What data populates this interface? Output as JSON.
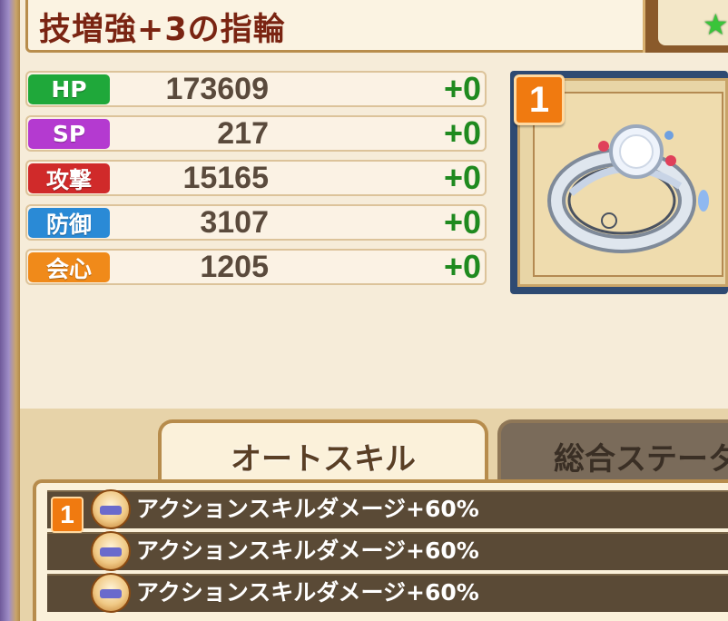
{
  "item": {
    "name": "技増強+3の指輪",
    "rarity": "1"
  },
  "stats": [
    {
      "label": "HP",
      "value": "173609",
      "bonus": "+0",
      "color": "#1fa83a"
    },
    {
      "label": "SP",
      "value": "217",
      "bonus": "+0",
      "color": "#b43ad0"
    },
    {
      "label": "攻撃",
      "value": "15165",
      "bonus": "+0",
      "color": "#d02a2a"
    },
    {
      "label": "防御",
      "value": "3107",
      "bonus": "+0",
      "color": "#2a8ad6"
    },
    {
      "label": "会心",
      "value": "1205",
      "bonus": "+0",
      "color": "#f08a1a"
    }
  ],
  "tabs": {
    "auto_skill": "オートスキル",
    "total_status": "総合ステータ"
  },
  "skills": {
    "level": "1",
    "items": [
      {
        "text": "アクションスキルダメージ+60%",
        "icon": "skill-chef-icon"
      },
      {
        "text": "アクションスキルダメージ+60%",
        "icon": "skill-chef-icon"
      },
      {
        "text": "アクションスキルダメージ+60%",
        "icon": "skill-chef-icon"
      }
    ]
  },
  "icons": {
    "corner": "star-icon",
    "item_image": "ring-icon"
  }
}
